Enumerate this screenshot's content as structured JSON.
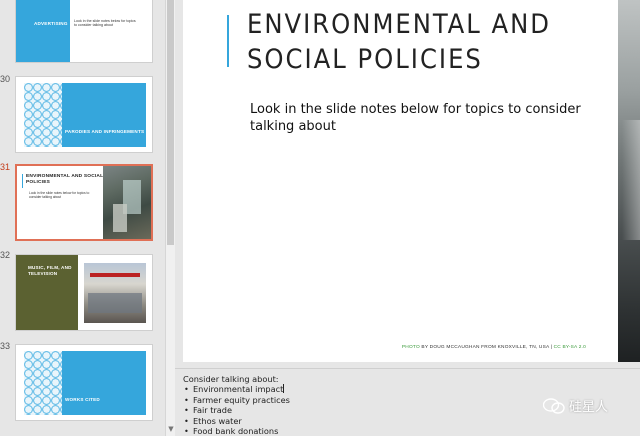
{
  "thumbnails": [
    {
      "number": "",
      "title": "ADVERTISING",
      "body": "Look in the slide notes below for topics to consider talking about"
    },
    {
      "number": "30",
      "title": "PARODIES AND INFRINGEMENTS"
    },
    {
      "number": "31",
      "title": "ENVIRONMENTAL AND SOCIAL POLICIES",
      "body": "Look in the slide notes below for topics to consider talking about",
      "active": true
    },
    {
      "number": "32",
      "title": "MUSIC, FILM, AND TELEVISION"
    },
    {
      "number": "33",
      "title": "WORKS CITED"
    }
  ],
  "slide": {
    "title": "ENVIRONMENTAL AND SOCIAL POLICIES",
    "body": "Look in the slide notes below for topics to consider talking about",
    "credit_photo": "PHOTO",
    "credit_mid": " BY DOUG MCCAUGHAN FROM KNOXVILLE, TN, USA | ",
    "credit_license": "CC BY-SA 2.0"
  },
  "notes": {
    "intro": "Consider talking about:",
    "items": [
      "Environmental impact",
      "Farmer equity practices",
      "Fair trade",
      "Ethos water",
      "Food bank donations"
    ]
  },
  "watermark": {
    "text": "硅星人"
  },
  "colors": {
    "accent": "#35a6dc",
    "active_border": "#e07056",
    "credit_link": "#3a9a3a",
    "olive": "#5b6131"
  }
}
